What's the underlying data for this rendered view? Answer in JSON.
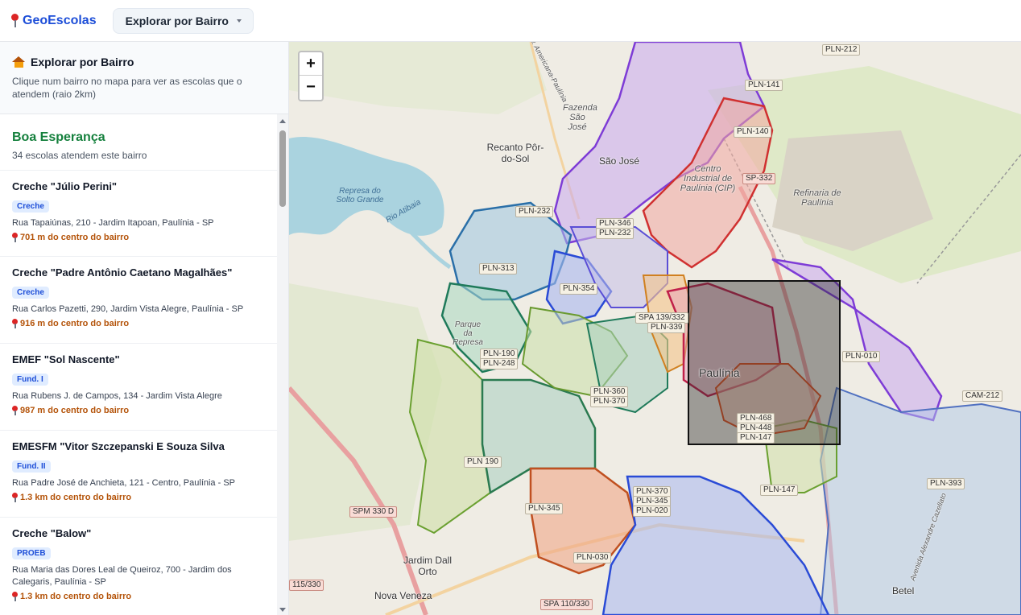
{
  "header": {
    "brand": "GeoEscolas",
    "mode_label": "Explorar por Bairro"
  },
  "sidebar": {
    "intro_title": "Explorar por Bairro",
    "intro_desc": "Clique num bairro no mapa para ver as escolas que o atendem (raio 2km)",
    "neighborhood": {
      "name": "Boa Esperança",
      "count_text": "34 escolas atendem este bairro"
    },
    "schools": [
      {
        "name": "Creche \"Júlio Perini\"",
        "badge": "Creche",
        "address": "Rua Tapaiúnas, 210 - Jardim Itapoan, Paulínia - SP",
        "distance": "701 m do centro do bairro"
      },
      {
        "name": "Creche \"Padre Antônio Caetano Magalhães\"",
        "badge": "Creche",
        "address": "Rua Carlos Pazetti, 290, Jardim Vista Alegre, Paulínia - SP",
        "distance": "916 m do centro do bairro"
      },
      {
        "name": "EMEF \"Sol Nascente\"",
        "badge": "Fund. I",
        "address": "Rua Rubens J. de Campos, 134 - Jardim Vista Alegre",
        "distance": "987 m do centro do bairro"
      },
      {
        "name": "EMESFM \"Vitor Szczepanski E Souza Silva",
        "badge": "Fund. II",
        "address": "Rua Padre José de Anchieta, 121 - Centro, Paulínia - SP",
        "distance": "1.3 km do centro do bairro"
      },
      {
        "name": "Creche \"Balow\"",
        "badge": "PROEB",
        "address": "Rua Maria das Dores Leal de Queiroz, 700 - Jardim dos Calegaris, Paulínia - SP",
        "distance": "1.3 km do centro do bairro"
      }
    ]
  },
  "map": {
    "zoom_in": "+",
    "zoom_out": "−",
    "road_labels": {
      "pln212": "PLN-212",
      "pln141": "PLN-141",
      "pln140": "PLN-140",
      "sp332": "SP-332",
      "pln232a": "PLN-232",
      "pln346": "PLN-346",
      "pln232b": "PLN-232",
      "pln313": "PLN-313",
      "pln354": "PLN-354",
      "spa139": "SPA 139/332",
      "pln339": "PLN-339",
      "pln190a": "PLN-190",
      "pln248": "PLN-248",
      "pln360": "PLN-360",
      "pln370a": "PLN-370",
      "pln468": "PLN-468",
      "pln448": "PLN-448",
      "pln147a": "PLN-147",
      "pln010": "PLN-010",
      "cam212": "CAM-212",
      "pln190b": "PLN 190",
      "pln345a": "PLN-345",
      "pln370b": "PLN-370",
      "pln345b": "PLN-345",
      "pln020": "PLN-020",
      "pln147b": "PLN-147",
      "pln393": "PLN-393",
      "spm330": "SPM 330 D",
      "pln030": "PLN-030",
      "spa110": "SPA 110/330",
      "r115": "115/330"
    },
    "places": {
      "recanto": "Recanto Pôr-do-Sol",
      "saojose": "São José",
      "fazenda": "Fazenda São José",
      "cip": "Centro Industrial de Paulínia (CIP)",
      "refinaria": "Refinaria de Paulínia",
      "represa": "Represa do Solto Grande",
      "rio": "Rio Atibaia",
      "parque": "Parque da Represa",
      "paulinia": "Paulínia",
      "jardim": "Jardim Dall Orto",
      "novaveneza": "Nova Veneza",
      "betel": "Betel",
      "avenida": "Avenida Alexandre Cazellato",
      "avamericana": "Av. Americana-Paulínia"
    }
  }
}
